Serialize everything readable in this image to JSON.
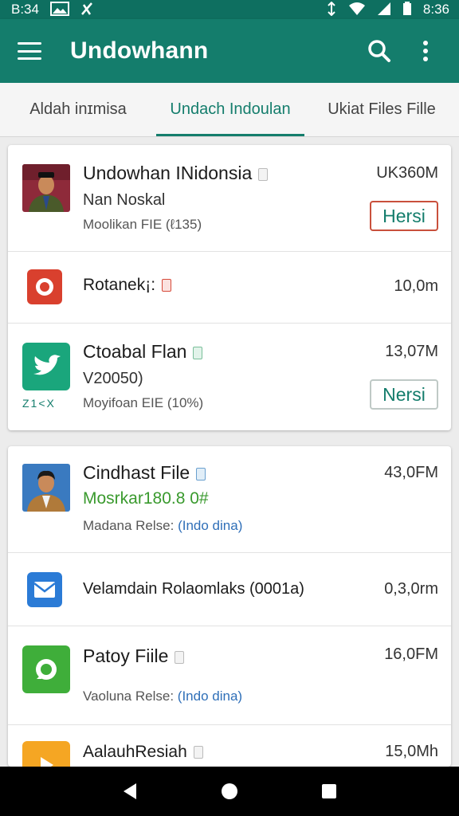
{
  "status_bar": {
    "time_left": "B:34",
    "time_right": "8:36"
  },
  "app_bar": {
    "title": "Undowhann"
  },
  "tabs": [
    {
      "label": "Aldah inɪmisa"
    },
    {
      "label": "Undach Indoulan"
    },
    {
      "label": "Ukiat Files Fille"
    }
  ],
  "card1": {
    "items": [
      {
        "name": "Undowhan INidonsia",
        "subtitle": "Nan Noskal",
        "meta": "Moolikan FIE (ℓ135)",
        "size": "UK360M",
        "action": "Hersi"
      },
      {
        "name": "Rotanek¡:",
        "size": "10,0m"
      },
      {
        "name": "Ctoabal Flan",
        "subtitle": "V20050)",
        "meta": "Moyifoan EIE (10%)",
        "size": "13,07M",
        "action": "Nersi",
        "icon_caption": "Z1<X"
      }
    ]
  },
  "card2": {
    "items": [
      {
        "name": "Cindhast File",
        "subtitle": "Mosrkar180.8 0#",
        "meta_prefix": "Madana Relse:",
        "meta_link": "(Indo dina)",
        "size": "43,0FM"
      },
      {
        "name": "Velamdain Rolaomlaks (0001a)",
        "size": "0,3,0rm"
      },
      {
        "name": "Patoy Fiile",
        "meta_prefix": "Vaoluna Relse:",
        "meta_link": "(Indo dina)",
        "size": "16,0FM"
      },
      {
        "name": "AalauhResiah",
        "size": "15,0Mh"
      }
    ]
  },
  "colors": {
    "primary": "#147d6c",
    "status_bar": "#0e6f60",
    "accent_red": "#c9503c",
    "link_blue": "#2f6fb8",
    "subtitle_green": "#3a9a2e"
  },
  "icons": [
    "menu-icon",
    "search-icon",
    "more-vert-icon",
    "back-icon",
    "home-icon",
    "recents-icon"
  ]
}
